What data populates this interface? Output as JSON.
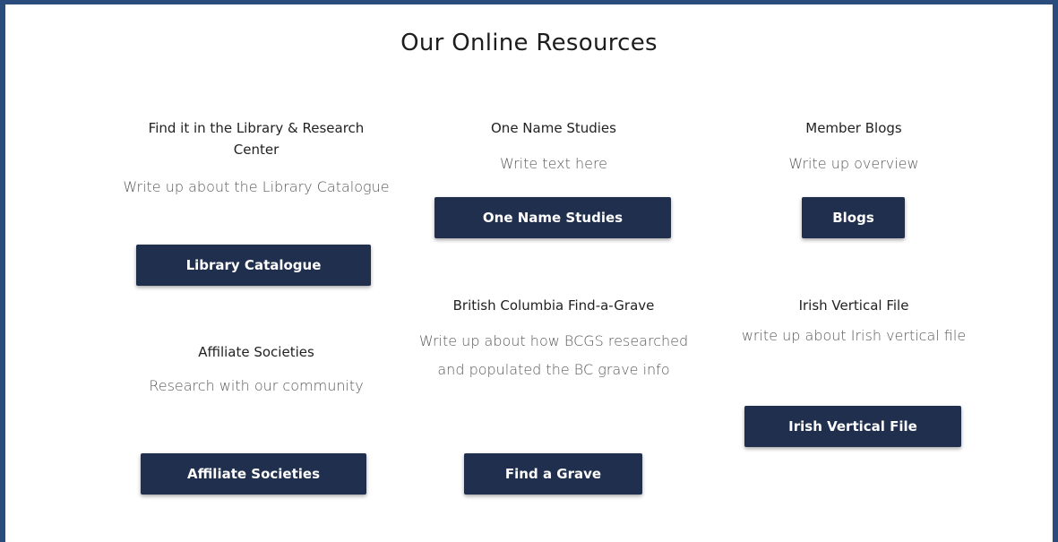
{
  "page": {
    "title": "Our Online Resources"
  },
  "resources": {
    "library": {
      "heading": "Find it in the Library & Research Center",
      "description": "Write up about the Library Catalogue",
      "button": "Library Catalogue"
    },
    "one_name": {
      "heading": "One Name Studies",
      "description": "Write text here",
      "button": "One Name Studies"
    },
    "blogs": {
      "heading": "Member Blogs",
      "description": "Write up overview",
      "button": "Blogs"
    },
    "affiliate": {
      "heading": "Affiliate Societies",
      "description": "Research with our community",
      "button": "Affiliate Societies"
    },
    "find_grave": {
      "heading": "British Columbia Find-a-Grave",
      "description": "Write up about how BCGS researched and populated the BC grave info",
      "button": "Find a Grave"
    },
    "irish": {
      "heading": "Irish Vertical File",
      "description": "write up about Irish vertical file",
      "button": "Irish Vertical File"
    }
  },
  "colors": {
    "frame_border": "#2a4c7d",
    "button_bg": "#1f2f4d",
    "button_text": "#ffffff"
  }
}
